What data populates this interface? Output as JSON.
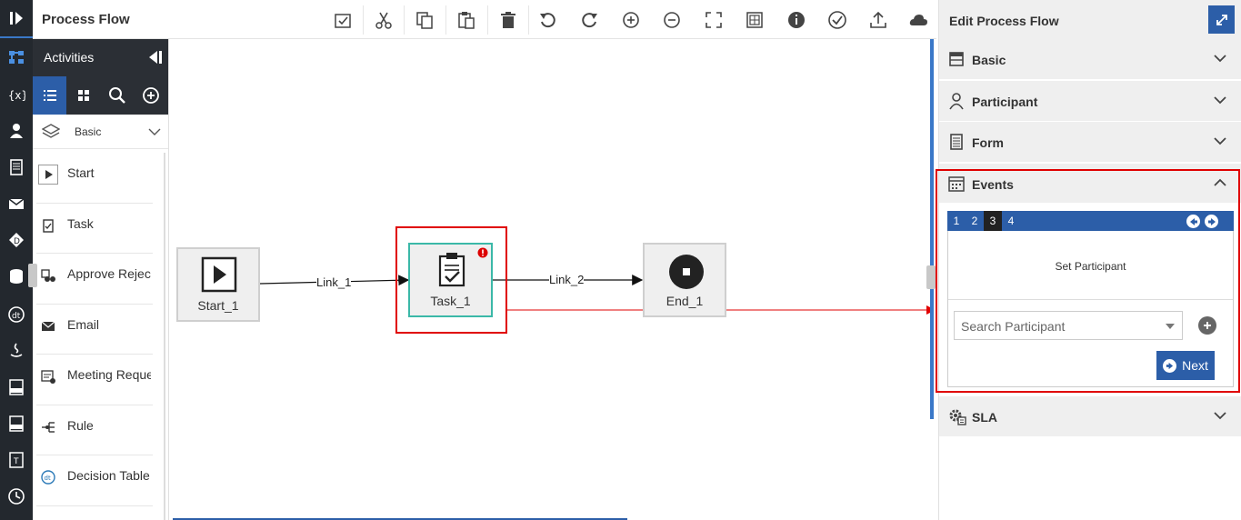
{
  "toolbar": {
    "title": "Process Flow",
    "buttons": [
      "validate-icon",
      "cut-icon",
      "copy-icon",
      "paste-icon",
      "delete-icon",
      "undo-icon",
      "redo-icon",
      "zoom-in-icon",
      "zoom-out-icon",
      "fit-icon",
      "grid-icon",
      "info-icon",
      "check-icon",
      "export-icon",
      "cloud-icon"
    ]
  },
  "activities": {
    "title": "Activities",
    "group": "Basic",
    "items": [
      {
        "label": "Start",
        "icon": "start-icon"
      },
      {
        "label": "Task",
        "icon": "task-icon"
      },
      {
        "label": "Approve Reject",
        "icon": "approve-reject-icon"
      },
      {
        "label": "Email",
        "icon": "email-icon"
      },
      {
        "label": "Meeting Request",
        "icon": "meeting-icon"
      },
      {
        "label": "Rule",
        "icon": "rule-icon"
      },
      {
        "label": "Decision Table",
        "icon": "decision-table-icon"
      }
    ]
  },
  "canvas": {
    "nodes": {
      "start": "Start_1",
      "task": "Task_1",
      "end": "End_1"
    },
    "links": {
      "link1": "Link_1",
      "link2": "Link_2"
    }
  },
  "panel": {
    "title": "Edit Process Flow",
    "sections": {
      "basic": "Basic",
      "participant": "Participant",
      "form": "Form",
      "events": "Events",
      "sla": "SLA"
    },
    "events": {
      "steps": [
        "1",
        "2",
        "3",
        "4"
      ],
      "active_step": "3",
      "subtitle": "Set Participant",
      "search_placeholder": "Search Participant",
      "next_label": "Next"
    }
  },
  "colors": {
    "accent": "#2c5ea8",
    "highlight": "#e00000",
    "task_border": "#3bb8a8"
  }
}
